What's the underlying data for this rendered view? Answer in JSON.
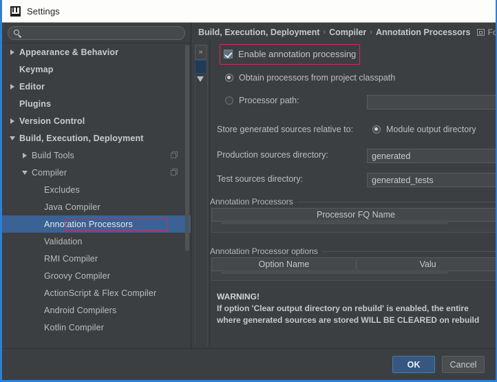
{
  "window": {
    "title": "Settings",
    "app_icon": "intellij-idea-icon"
  },
  "sidebar": {
    "search": {
      "value": "",
      "placeholder": "",
      "icon": "search-icon"
    },
    "items": [
      {
        "label": "Appearance & Behavior",
        "arrow": "right",
        "indent": 0,
        "bold": true,
        "selected": false,
        "copy_icon": false
      },
      {
        "label": "Keymap",
        "arrow": "none",
        "indent": 0,
        "bold": true,
        "selected": false,
        "copy_icon": false
      },
      {
        "label": "Editor",
        "arrow": "right",
        "indent": 0,
        "bold": true,
        "selected": false,
        "copy_icon": false
      },
      {
        "label": "Plugins",
        "arrow": "none",
        "indent": 0,
        "bold": true,
        "selected": false,
        "copy_icon": false
      },
      {
        "label": "Version Control",
        "arrow": "right",
        "indent": 0,
        "bold": true,
        "selected": false,
        "copy_icon": false
      },
      {
        "label": "Build, Execution, Deployment",
        "arrow": "down",
        "indent": 0,
        "bold": true,
        "selected": false,
        "copy_icon": false
      },
      {
        "label": "Build Tools",
        "arrow": "right",
        "indent": 1,
        "bold": false,
        "selected": false,
        "copy_icon": true
      },
      {
        "label": "Compiler",
        "arrow": "down",
        "indent": 1,
        "bold": false,
        "selected": false,
        "copy_icon": true
      },
      {
        "label": "Excludes",
        "arrow": "none",
        "indent": 2,
        "bold": false,
        "selected": false,
        "copy_icon": false
      },
      {
        "label": "Java Compiler",
        "arrow": "none",
        "indent": 2,
        "bold": false,
        "selected": false,
        "copy_icon": false
      },
      {
        "label": "Annotation Processors",
        "arrow": "none",
        "indent": 2,
        "bold": false,
        "selected": true,
        "copy_icon": false
      },
      {
        "label": "Validation",
        "arrow": "none",
        "indent": 2,
        "bold": false,
        "selected": false,
        "copy_icon": false
      },
      {
        "label": "RMI Compiler",
        "arrow": "none",
        "indent": 2,
        "bold": false,
        "selected": false,
        "copy_icon": false
      },
      {
        "label": "Groovy Compiler",
        "arrow": "none",
        "indent": 2,
        "bold": false,
        "selected": false,
        "copy_icon": false
      },
      {
        "label": "ActionScript & Flex Compiler",
        "arrow": "none",
        "indent": 2,
        "bold": false,
        "selected": false,
        "copy_icon": false
      },
      {
        "label": "Android Compilers",
        "arrow": "none",
        "indent": 2,
        "bold": false,
        "selected": false,
        "copy_icon": false
      },
      {
        "label": "Kotlin Compiler",
        "arrow": "none",
        "indent": 2,
        "bold": false,
        "selected": false,
        "copy_icon": false
      }
    ]
  },
  "breadcrumb": {
    "parts": [
      "Build, Execution, Deployment",
      "Compiler",
      "Annotation Processors"
    ],
    "separator": "›",
    "module_label": "Fo",
    "module_icon": "module-icon"
  },
  "gutter": {
    "expand_label": "»"
  },
  "main": {
    "enable_checkbox": {
      "label": "Enable annotation processing",
      "checked": true
    },
    "radio_classpath": {
      "label": "Obtain processors from project classpath",
      "selected": true
    },
    "radio_processor_path": {
      "label": "Processor path:",
      "selected": false
    },
    "processor_path_value": "",
    "store_relative_label": "Store generated sources relative to:",
    "radio_module_output": {
      "label": "Module output directory",
      "selected": true
    },
    "production_label": "Production sources directory:",
    "production_value": "generated",
    "test_label": "Test sources directory:",
    "test_value": "generated_tests",
    "section_processors": "Annotation Processors",
    "table_processors_header": [
      "Processor FQ Name"
    ],
    "section_options": "Annotation Processor options",
    "table_options_header": [
      "Option Name",
      "Valu"
    ],
    "warning_title": "WARNING!",
    "warning_line1": "If option 'Clear output directory on rebuild' is enabled, the entire",
    "warning_line2": "where generated sources are stored WILL BE CLEARED on rebuild"
  },
  "footer": {
    "ok_label": "OK",
    "cancel_label": "Cancel"
  },
  "colors": {
    "accent_blue": "#2f7fd4",
    "selection_blue": "#3a6294",
    "highlight_red": "#d7295a",
    "panel_bg": "#3c3f41",
    "primary_button": "#365880"
  }
}
